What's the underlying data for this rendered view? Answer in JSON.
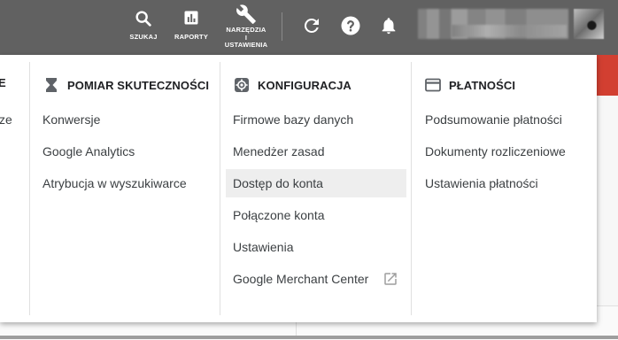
{
  "topbar": {
    "search_label": "SZUKAJ",
    "reports_label": "RAPORTY",
    "tools_label_line1": "NARZĘDZIA",
    "tools_label_line2": "I",
    "tools_label_line3": "USTAWIENIA",
    "refresh_icon": "refresh-icon",
    "help_icon": "help-icon",
    "notifications_icon": "bell-icon",
    "background_color": "#616161"
  },
  "dropdown": {
    "partial_column": {
      "header_fragment": "E",
      "item_fragment": "cze"
    },
    "measurement": {
      "icon": "hourglass-icon",
      "header": "POMIAR SKUTECZNOŚCI",
      "items": [
        "Konwersje",
        "Google Analytics",
        "Atrybucja w wyszukiwarce"
      ]
    },
    "setup": {
      "icon": "gear-icon",
      "header": "KONFIGURACJA",
      "items": [
        "Firmowe bazy danych",
        "Menedżer zasad",
        "Dostęp do konta",
        "Połączone konta",
        "Ustawienia",
        "Google Merchant Center"
      ],
      "hovered_item": "Dostęp do konta"
    },
    "billing": {
      "icon": "credit-card-icon",
      "header": "PŁATNOŚCI",
      "items": [
        "Podsumowanie płatności",
        "Dokumenty rozliczeniowe",
        "Ustawienia płatności"
      ]
    }
  }
}
